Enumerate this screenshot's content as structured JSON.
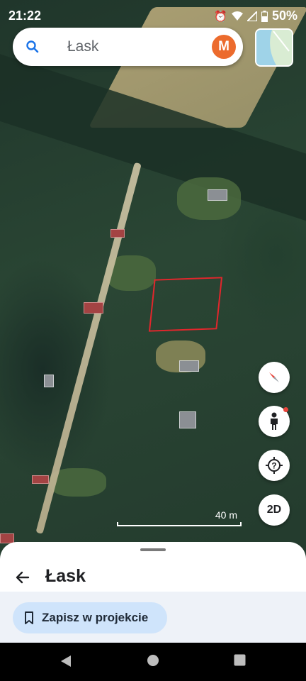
{
  "status_bar": {
    "time": "21:22",
    "battery": "50%",
    "icons": [
      "alarm-icon",
      "wifi-icon",
      "signal-icon",
      "battery-icon"
    ]
  },
  "search": {
    "query": "Łask",
    "avatar_initial": "M"
  },
  "map": {
    "scale_label": "40 m"
  },
  "controls": {
    "view_toggle": "2D"
  },
  "sheet": {
    "title": "Łask",
    "save_label": "Zapisz w projekcie"
  },
  "colors": {
    "accent_avatar": "#ec6b2d",
    "chip_bg": "#cfe4fb",
    "plot_outline": "#e2262c"
  }
}
